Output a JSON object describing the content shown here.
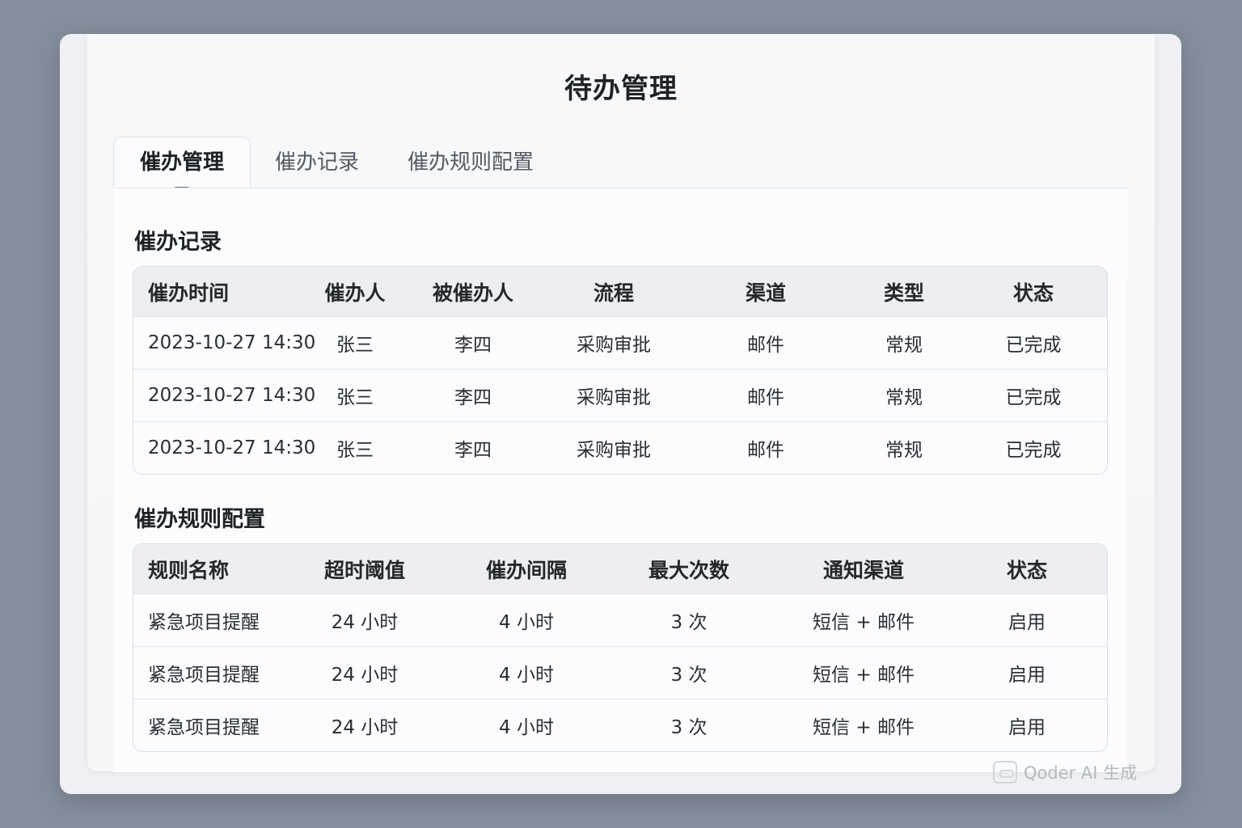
{
  "page": {
    "title": "待办管理"
  },
  "tabs": [
    {
      "label": "催办管理",
      "active": true
    },
    {
      "label": "催办记录",
      "active": false
    },
    {
      "label": "催办规则配置",
      "active": false
    }
  ],
  "records": {
    "title": "催办记录",
    "columns": [
      "催办时间",
      "催办人",
      "被催办人",
      "流程",
      "渠道",
      "类型",
      "状态"
    ],
    "rows": [
      [
        "2023-10-27 14:30",
        "张三",
        "李四",
        "采购审批",
        "邮件",
        "常规",
        "已完成"
      ],
      [
        "2023-10-27 14:30",
        "张三",
        "李四",
        "采购审批",
        "邮件",
        "常规",
        "已完成"
      ],
      [
        "2023-10-27 14:30",
        "张三",
        "李四",
        "采购审批",
        "邮件",
        "常规",
        "已完成"
      ]
    ]
  },
  "rules": {
    "title": "催办规则配置",
    "columns": [
      "规则名称",
      "超时阈值",
      "催办间隔",
      "最大次数",
      "通知渠道",
      "状态"
    ],
    "rows": [
      [
        "紧急项目提醒",
        "24 小时",
        "4 小时",
        "3 次",
        "短信 + 邮件",
        "启用"
      ],
      [
        "紧急项目提醒",
        "24 小时",
        "4 小时",
        "3 次",
        "短信 + 邮件",
        "启用"
      ],
      [
        "紧急项目提醒",
        "24 小时",
        "4 小时",
        "3 次",
        "短信 + 邮件",
        "启用"
      ]
    ]
  },
  "watermark": {
    "text": "Qoder AI 生成",
    "icon": "qoder-logo-icon"
  }
}
